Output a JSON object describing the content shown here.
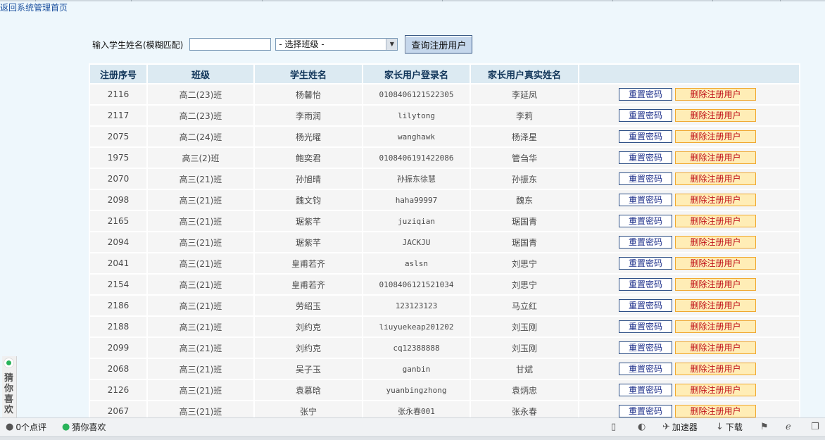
{
  "nav": {
    "home_link": "返回系统管理首页"
  },
  "search": {
    "label": "输入学生姓名(模糊匹配)",
    "name_value": "",
    "class_select": "- 选择班级 -",
    "query_button": "查询注册用户"
  },
  "table": {
    "headers": [
      "注册序号",
      "班级",
      "学生姓名",
      "家长用户登录名",
      "家长用户真实姓名",
      ""
    ],
    "reset_label": "重置密码",
    "delete_label": "删除注册用户",
    "rows": [
      {
        "id": "2116",
        "class": "高二(23)班",
        "student": "杨馨怡",
        "login": "0108406121522305",
        "parent": "李延凤"
      },
      {
        "id": "2117",
        "class": "高二(23)班",
        "student": "李雨润",
        "login": "lilytong",
        "parent": "李莉"
      },
      {
        "id": "2075",
        "class": "高二(24)班",
        "student": "杨光曜",
        "login": "wanghawk",
        "parent": "杨泽星"
      },
      {
        "id": "1975",
        "class": "高三(2)班",
        "student": "鲍奕君",
        "login": "0108406191422086",
        "parent": "管刍华"
      },
      {
        "id": "2070",
        "class": "高三(21)班",
        "student": "孙旭晴",
        "login": "孙振东徐慧",
        "parent": "孙振东"
      },
      {
        "id": "2098",
        "class": "高三(21)班",
        "student": "魏文钧",
        "login": "haha99997",
        "parent": "魏东"
      },
      {
        "id": "2165",
        "class": "高三(21)班",
        "student": "琚紫芊",
        "login": "juziqian",
        "parent": "琚国青"
      },
      {
        "id": "2094",
        "class": "高三(21)班",
        "student": "琚紫芊",
        "login": "JACKJU",
        "parent": "琚国青"
      },
      {
        "id": "2041",
        "class": "高三(21)班",
        "student": "皇甫若齐",
        "login": "aslsn",
        "parent": "刘思宁"
      },
      {
        "id": "2154",
        "class": "高三(21)班",
        "student": "皇甫若齐",
        "login": "0108406121521034",
        "parent": "刘思宁"
      },
      {
        "id": "2186",
        "class": "高三(21)班",
        "student": "劳绍玉",
        "login": "123123123",
        "parent": "马立红"
      },
      {
        "id": "2188",
        "class": "高三(21)班",
        "student": "刘约克",
        "login": "liuyuekeap201202",
        "parent": "刘玉刚"
      },
      {
        "id": "2099",
        "class": "高三(21)班",
        "student": "刘约克",
        "login": "cq12388888",
        "parent": "刘玉刚"
      },
      {
        "id": "2068",
        "class": "高三(21)班",
        "student": "吴子玉",
        "login": "ganbin",
        "parent": "甘斌"
      },
      {
        "id": "2126",
        "class": "高三(21)班",
        "student": "袁慕晗",
        "login": "yuanbingzhong",
        "parent": "袁炳忠"
      },
      {
        "id": "2067",
        "class": "高三(21)班",
        "student": "张宁",
        "login": "张永春001",
        "parent": "张永春"
      }
    ]
  },
  "side_widget": {
    "label": "猜你喜欢"
  },
  "statusbar": {
    "comments": "0个点评",
    "guess": "猜你喜欢",
    "accelerator": "加速器",
    "download": "下载"
  },
  "colors": {
    "page_bg": "#eef7fc",
    "header_bg": "#dceaf2",
    "row_bg": "#f5f5f5",
    "delete_bg": "#ffedb6",
    "delete_text": "#c0111a",
    "reset_text": "#1d2f8a"
  }
}
